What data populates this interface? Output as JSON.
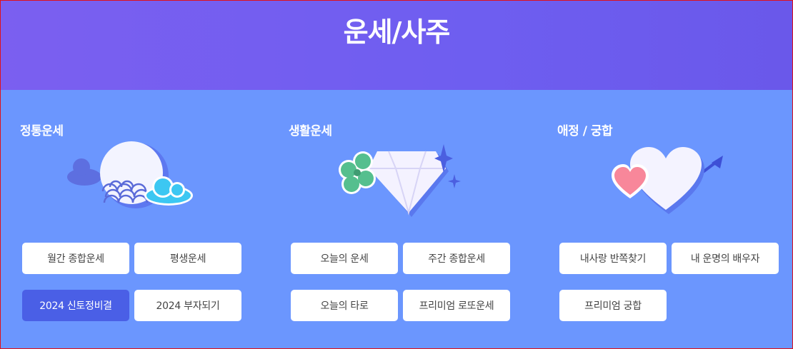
{
  "header": {
    "title": "운세/사주"
  },
  "sections": [
    {
      "title": "정통운세",
      "buttons": [
        "월간 종합운세",
        "평생운세",
        "2024 신토정비결",
        "2024 부자되기"
      ]
    },
    {
      "title": "생활운세",
      "buttons": [
        "오늘의 운세",
        "주간 종합운세",
        "오늘의 타로",
        "프리미엄 로또운세"
      ]
    },
    {
      "title": "애정 / 궁합",
      "buttons": [
        "내사랑 반쪽찾기",
        "내 운명의 배우자",
        "프리미엄 궁합"
      ]
    }
  ],
  "colors": {
    "header_bg": "#7060ef",
    "main_bg": "#6b96fe",
    "active_button": "#4a5fe6",
    "button_bg": "#ffffff"
  },
  "icons": [
    "moon-cloud-icon",
    "clover-diamond-icon",
    "hearts-arrow-icon"
  ]
}
